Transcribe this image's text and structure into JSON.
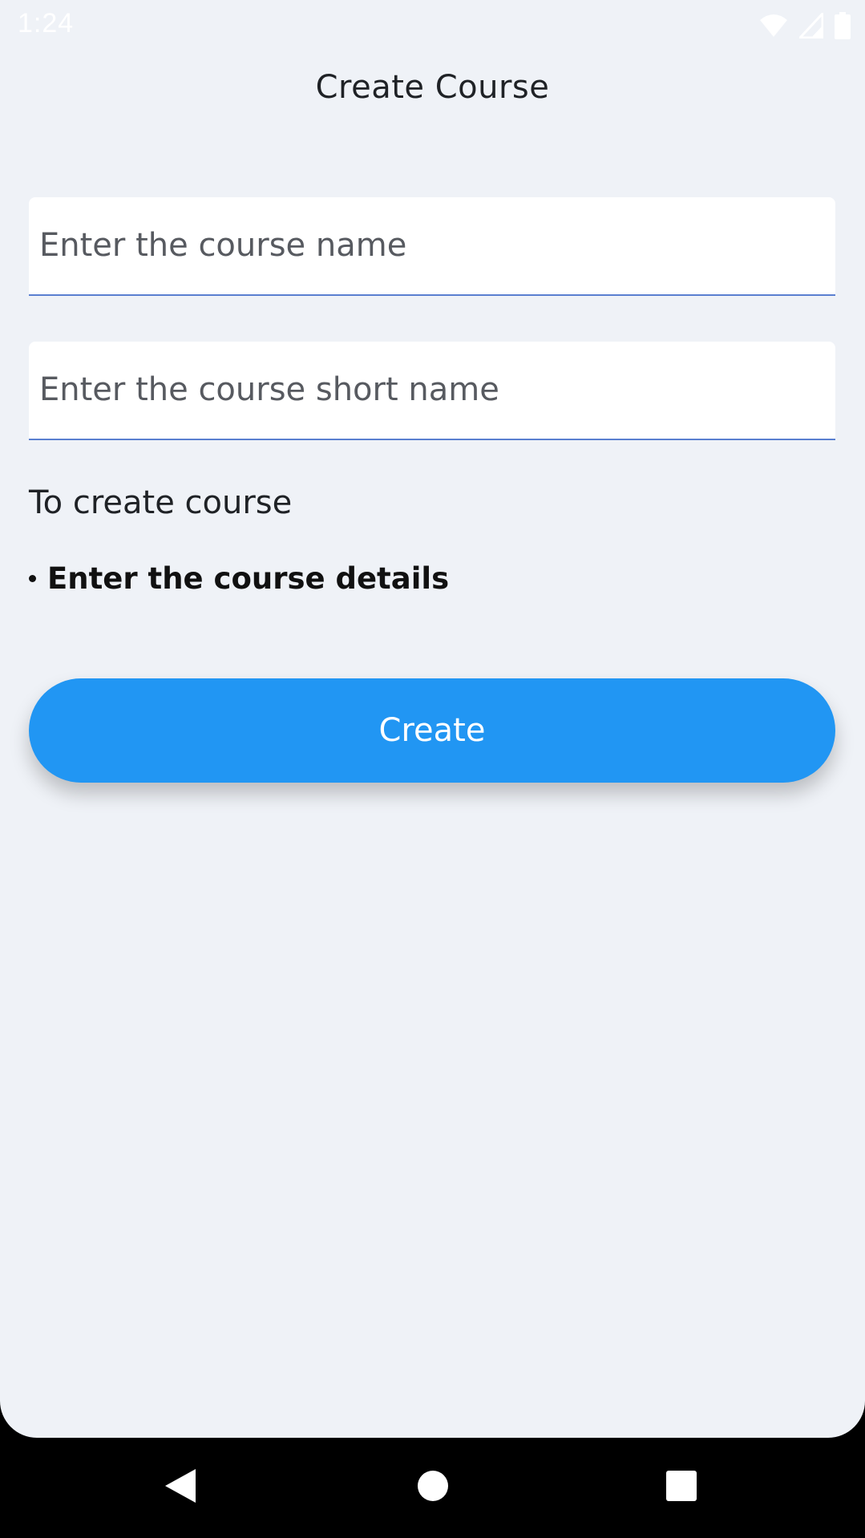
{
  "status_bar": {
    "time": "1:24",
    "icons": [
      "wifi-icon",
      "signal-icon",
      "battery-icon"
    ]
  },
  "page": {
    "title": "Create Course"
  },
  "form": {
    "course_name_placeholder": "Enter the course name",
    "course_name_value": "",
    "short_name_placeholder": "Enter the course short name",
    "short_name_value": ""
  },
  "instructions": {
    "heading": "To create course",
    "items": [
      "Enter the course details"
    ]
  },
  "actions": {
    "create_label": "Create"
  },
  "navigation": {
    "buttons": [
      "back-icon",
      "home-icon",
      "recents-icon"
    ]
  },
  "colors": {
    "background": "#eff2f7",
    "accent": "#2196f3",
    "field_underline": "#5a7fd0",
    "nav_bar": "#000000"
  }
}
